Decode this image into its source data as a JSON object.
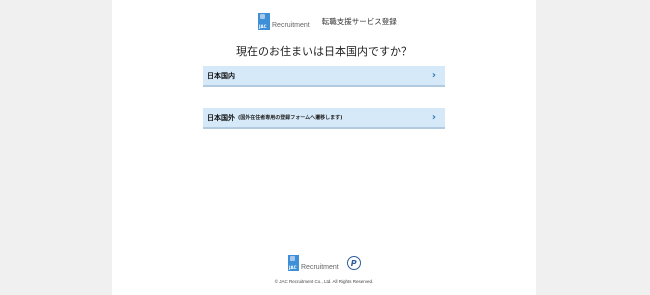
{
  "header": {
    "logo_mark_text": "JAC",
    "logo_text": "Recruitment",
    "title": "転職支援サービス登録"
  },
  "question": "現在のお住まいは日本国内ですか？",
  "options": [
    {
      "label": "日本国内",
      "note": ""
    },
    {
      "label": "日本国外",
      "note": "(国外在住者専用の登録フォームへ遷移します)"
    }
  ],
  "footer": {
    "logo_mark_text": "JAC",
    "logo_text": "Recruitment",
    "privacy_mark": "P",
    "copyright": "© JAC Recruitment Co., Ltd. All Rights Reserved."
  },
  "colors": {
    "option_bg": "#d6e9f9",
    "chevron": "#2e75b6",
    "brand": "#3d8fd8"
  },
  "icons": {
    "chevron": "chevron-right-icon",
    "privacy": "privacy-mark-icon"
  }
}
